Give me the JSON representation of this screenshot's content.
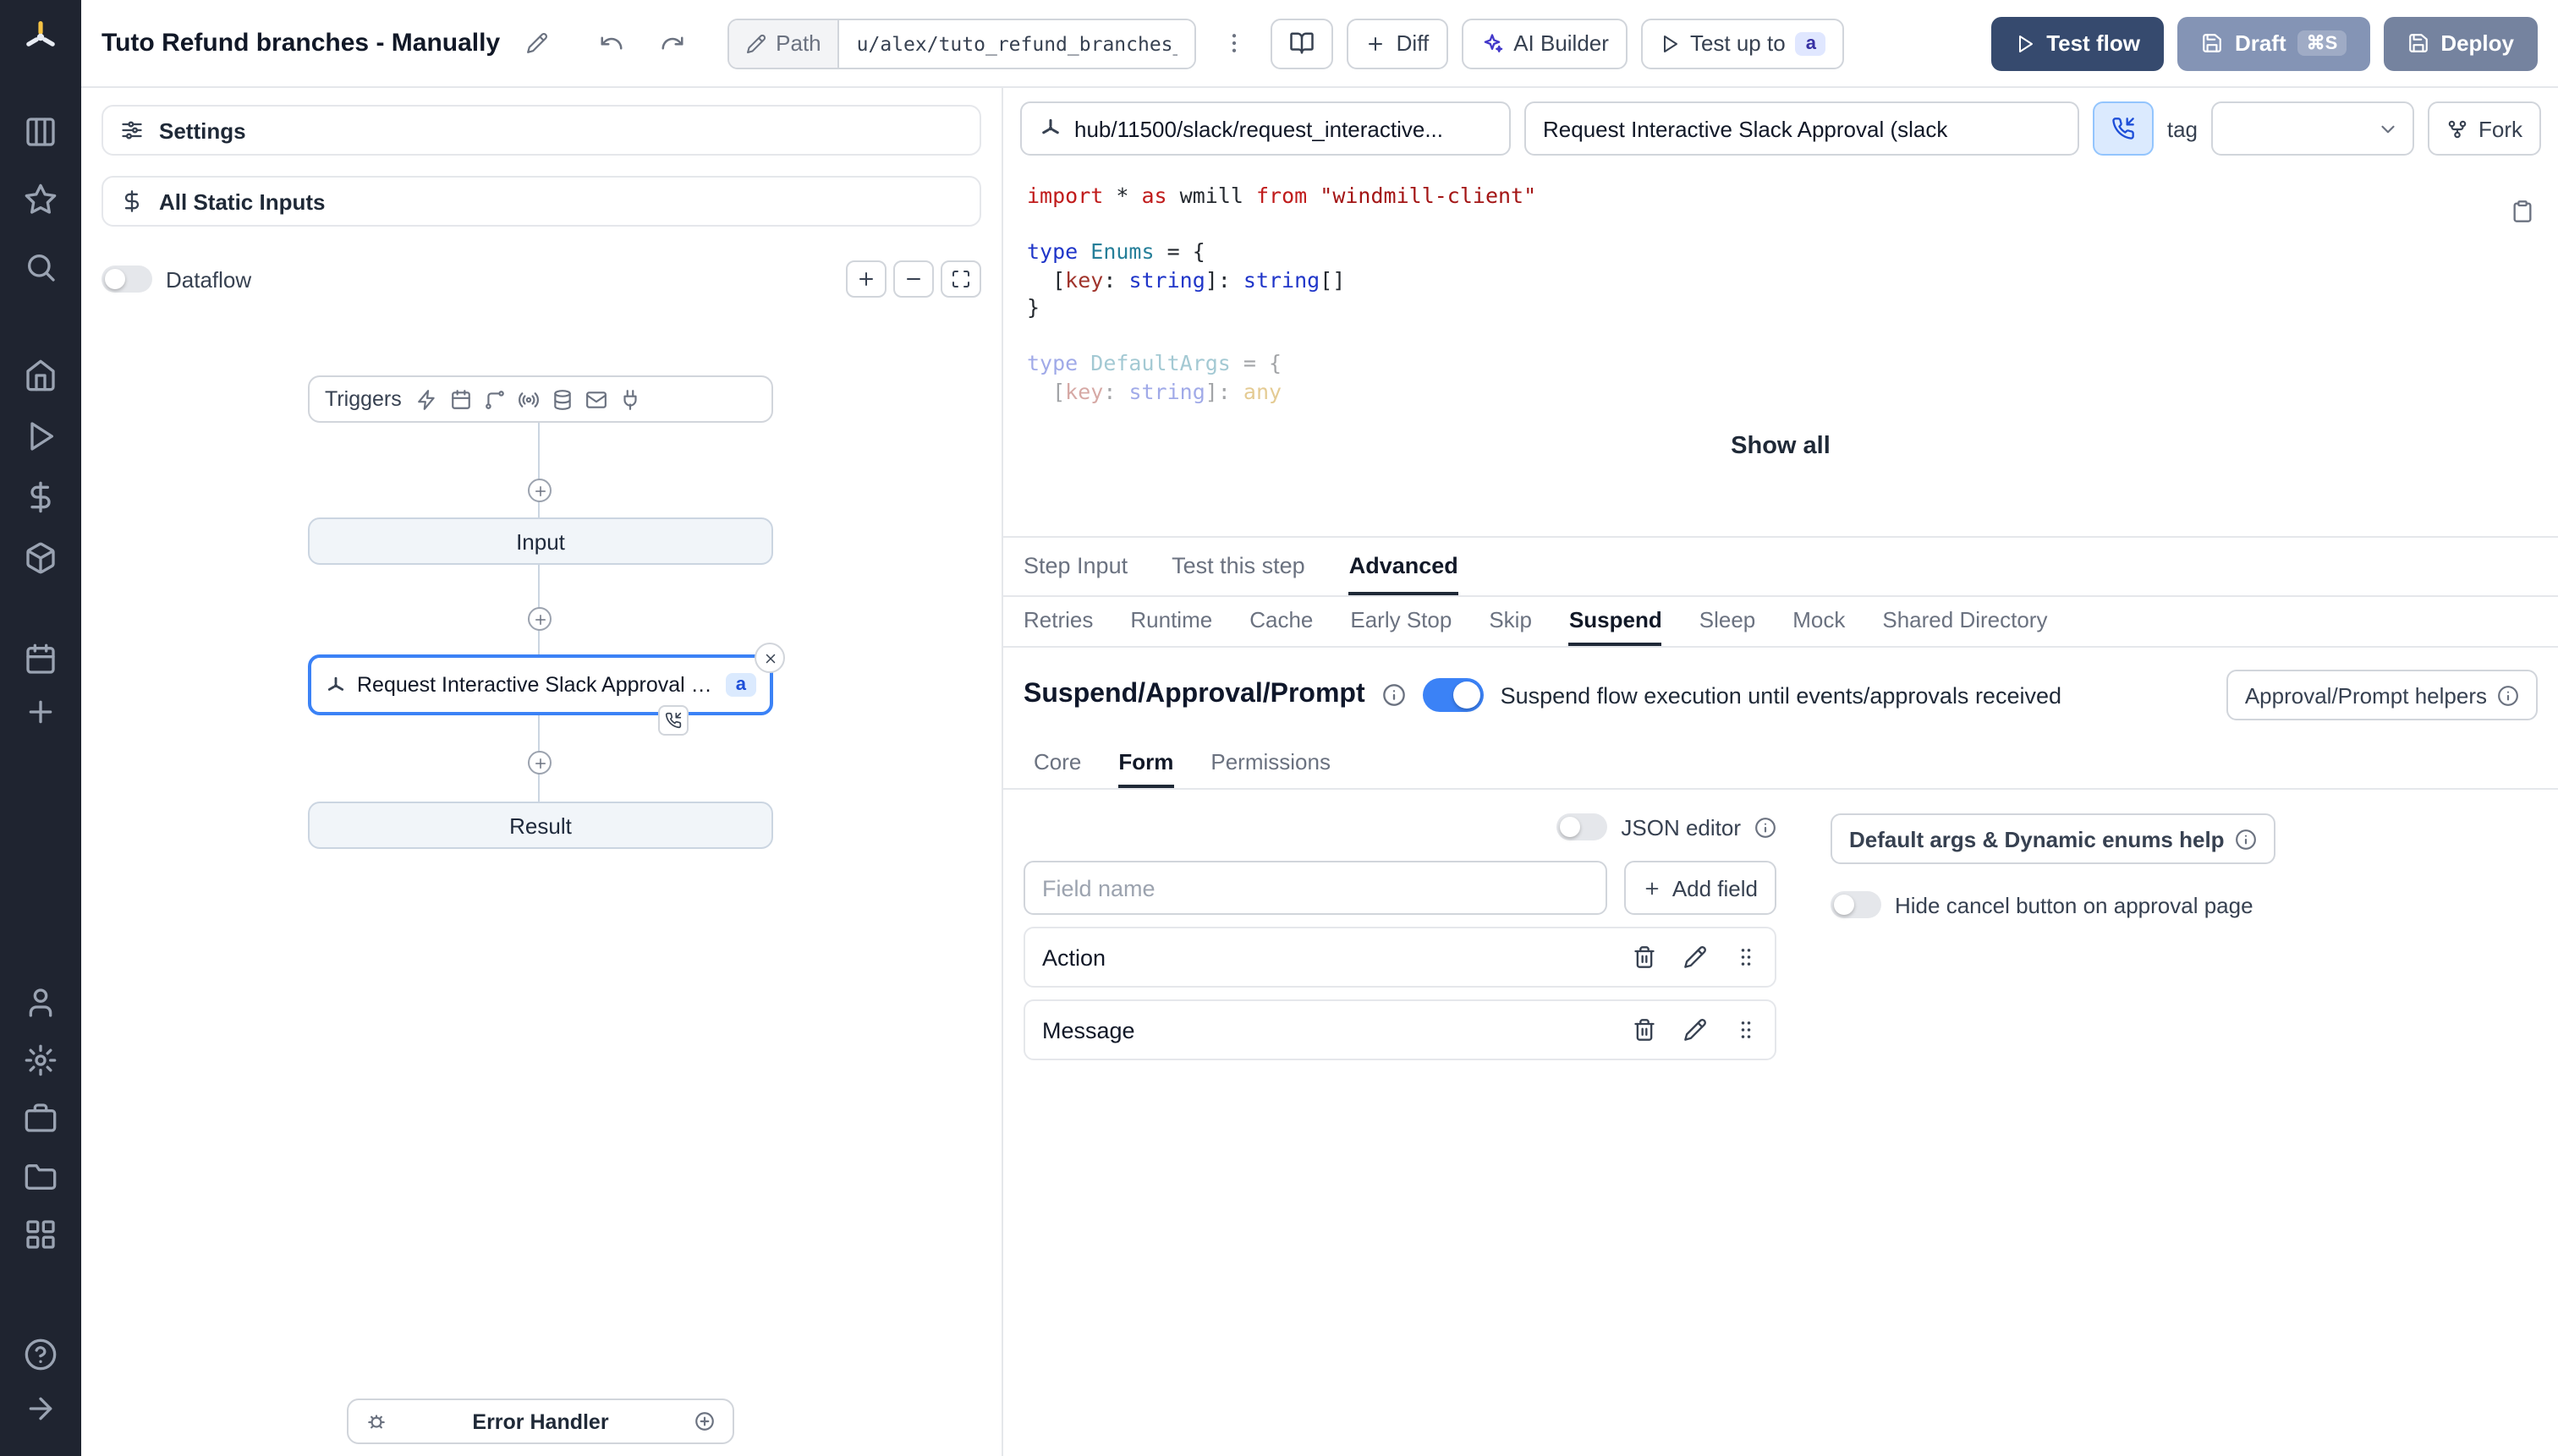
{
  "colors": {
    "accent": "#3b82f6",
    "sidebar_bg": "#1f2430",
    "btn_navy": "#364a6e",
    "btn_draft": "#8494b5",
    "btn_deploy": "#75839f",
    "border": "#e5e7eb"
  },
  "sidebar": {
    "logo": "windmill-logo",
    "icons": [
      "apps",
      "favorites",
      "search",
      "home",
      "runs",
      "variables",
      "resources",
      "schedules",
      "create",
      "user",
      "settings",
      "workers",
      "folders",
      "groups",
      "help",
      "expand"
    ]
  },
  "header": {
    "title": "Tuto Refund branches - Manually",
    "path": {
      "label": "Path",
      "value": "u/alex/tuto_refund_branches__"
    },
    "diff_label": "Diff",
    "ai_builder_label": "AI Builder",
    "test_up_to": {
      "label": "Test up to",
      "badge": "a"
    },
    "test_flow_label": "Test flow",
    "draft": {
      "label": "Draft",
      "shortcut": "⌘S"
    },
    "deploy_label": "Deploy"
  },
  "flow_panel": {
    "settings_label": "Settings",
    "static_inputs_label": "All Static Inputs",
    "dataflow_label": "Dataflow",
    "graph": {
      "triggers_label": "Triggers",
      "trigger_icons": [
        "webhook-icon",
        "schedule-icon",
        "http-route-icon",
        "websocket-icon",
        "postgres-icon",
        "email-icon",
        "kafka-icon"
      ],
      "input_label": "Input",
      "step": {
        "label": "Request Interactive Slack Approval (...",
        "badge": "a"
      },
      "result_label": "Result",
      "error_handler_label": "Error Handler"
    }
  },
  "editor": {
    "hub_path": "hub/11500/slack/request_interactive...",
    "step_name": "Request Interactive Slack Approval (slack",
    "tag_label": "tag",
    "fork_label": "Fork",
    "show_all_label": "Show all",
    "code": [
      {
        "tokens": [
          {
            "t": "import",
            "c": "kw"
          },
          {
            "t": " ",
            "c": "pl"
          },
          {
            "t": "*",
            "c": "pl"
          },
          {
            "t": " ",
            "c": "pl"
          },
          {
            "t": "as",
            "c": "kw"
          },
          {
            "t": " wmill ",
            "c": "pl"
          },
          {
            "t": "from",
            "c": "kw"
          },
          {
            "t": " ",
            "c": "pl"
          },
          {
            "t": "\"windmill-client\"",
            "c": "str"
          }
        ]
      },
      {
        "tokens": []
      },
      {
        "tokens": [
          {
            "t": "type",
            "c": "ty"
          },
          {
            "t": " ",
            "c": "pl"
          },
          {
            "t": "Enums",
            "c": "tn"
          },
          {
            "t": " = {",
            "c": "pl"
          }
        ]
      },
      {
        "tokens": [
          {
            "t": "  [",
            "c": "pl"
          },
          {
            "t": "key",
            "c": "pr"
          },
          {
            "t": ": ",
            "c": "pl"
          },
          {
            "t": "string",
            "c": "ty"
          },
          {
            "t": "]: ",
            "c": "pl"
          },
          {
            "t": "string",
            "c": "ty"
          },
          {
            "t": "[]",
            "c": "pl"
          }
        ]
      },
      {
        "tokens": [
          {
            "t": "}",
            "c": "pl"
          }
        ]
      },
      {
        "tokens": []
      },
      {
        "faded": true,
        "tokens": [
          {
            "t": "type",
            "c": "ty"
          },
          {
            "t": " ",
            "c": "pl"
          },
          {
            "t": "DefaultArgs",
            "c": "tn"
          },
          {
            "t": " = {",
            "c": "pl"
          }
        ]
      },
      {
        "faded": true,
        "tokens": [
          {
            "t": "  [",
            "c": "pl"
          },
          {
            "t": "key",
            "c": "pr"
          },
          {
            "t": ": ",
            "c": "pl"
          },
          {
            "t": "string",
            "c": "ty"
          },
          {
            "t": "]: ",
            "c": "pl"
          },
          {
            "t": "any",
            "c": "an"
          }
        ]
      }
    ]
  },
  "tabs": {
    "step_tabs": [
      "Step Input",
      "Test this step",
      "Advanced"
    ],
    "advanced_tabs": [
      "Retries",
      "Runtime",
      "Cache",
      "Early Stop",
      "Skip",
      "Suspend",
      "Sleep",
      "Mock",
      "Shared Directory"
    ],
    "suspend_tabs": [
      "Core",
      "Form",
      "Permissions"
    ]
  },
  "suspend": {
    "heading": "Suspend/Approval/Prompt",
    "toggle_description": "Suspend flow execution until events/approvals received",
    "helpers_button": "Approval/Prompt helpers"
  },
  "form": {
    "json_editor_label": "JSON editor",
    "field_name_placeholder": "Field name",
    "add_field_label": "Add field",
    "default_args_button": "Default args & Dynamic enums help",
    "hide_cancel_label": "Hide cancel button on approval page",
    "fields": [
      {
        "name": "Action"
      },
      {
        "name": "Message"
      }
    ]
  }
}
